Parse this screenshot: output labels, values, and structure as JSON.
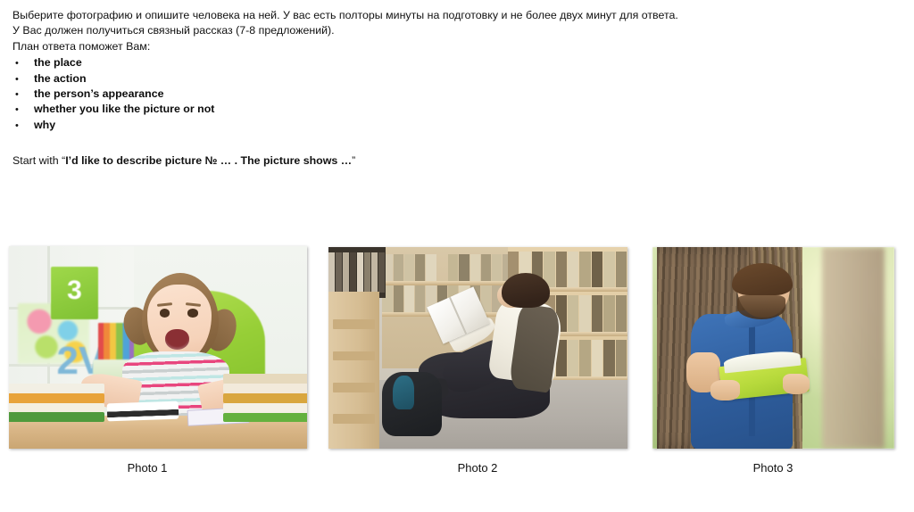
{
  "slide": {
    "background_color": "#ffffff",
    "instructions": [
      "Выберите фотографию и опишите человека на ней. У вас есть полторы минуты на подготовку и не более двух минут для ответа.",
      "У Вас должен получиться связный рассказ (7-8 предложений).",
      "План ответа поможет Вам:"
    ],
    "plan_bullet": "•",
    "plan_items": [
      "the place",
      "the action",
      "the person’s appearance",
      "whether you like the picture or not",
      "why"
    ],
    "start_prefix": "Start with “",
    "start_quote": "I’d like to describe picture № … . The picture shows …",
    "start_suffix": "”"
  },
  "photos": [
    {
      "caption": "Photo 1",
      "alt": "Excited little girl with pigtails sitting at a desk with stacks of books and an open book, green chair behind her, white shelving with colourful toys in the background",
      "dominant_colors": {
        "chair": "#97cf37",
        "background": "#eef2ec",
        "desk": "#d9b687",
        "shirt_stripe": "#e8467e"
      }
    },
    {
      "caption": "Photo 2",
      "alt": "Teenage boy in a white shirt and dark vest sitting on the floor of a library aisle reading a book, black backpack beside him, wooden bookshelves full of books",
      "dominant_colors": {
        "shelves": "#d9c398",
        "floor": "#b2ada6",
        "vest": "#514a3e",
        "backpack": "#1c1e21"
      }
    },
    {
      "caption": "Photo 3",
      "alt": "Young bearded man in a blue shirt leaning against a large tree trunk outdoors, reading a book with a bright green cover",
      "dominant_colors": {
        "shirt": "#2f5e9e",
        "trunk": "#7d6750",
        "foliage": "#b9cf8d",
        "book": "#b6d93b"
      }
    }
  ]
}
